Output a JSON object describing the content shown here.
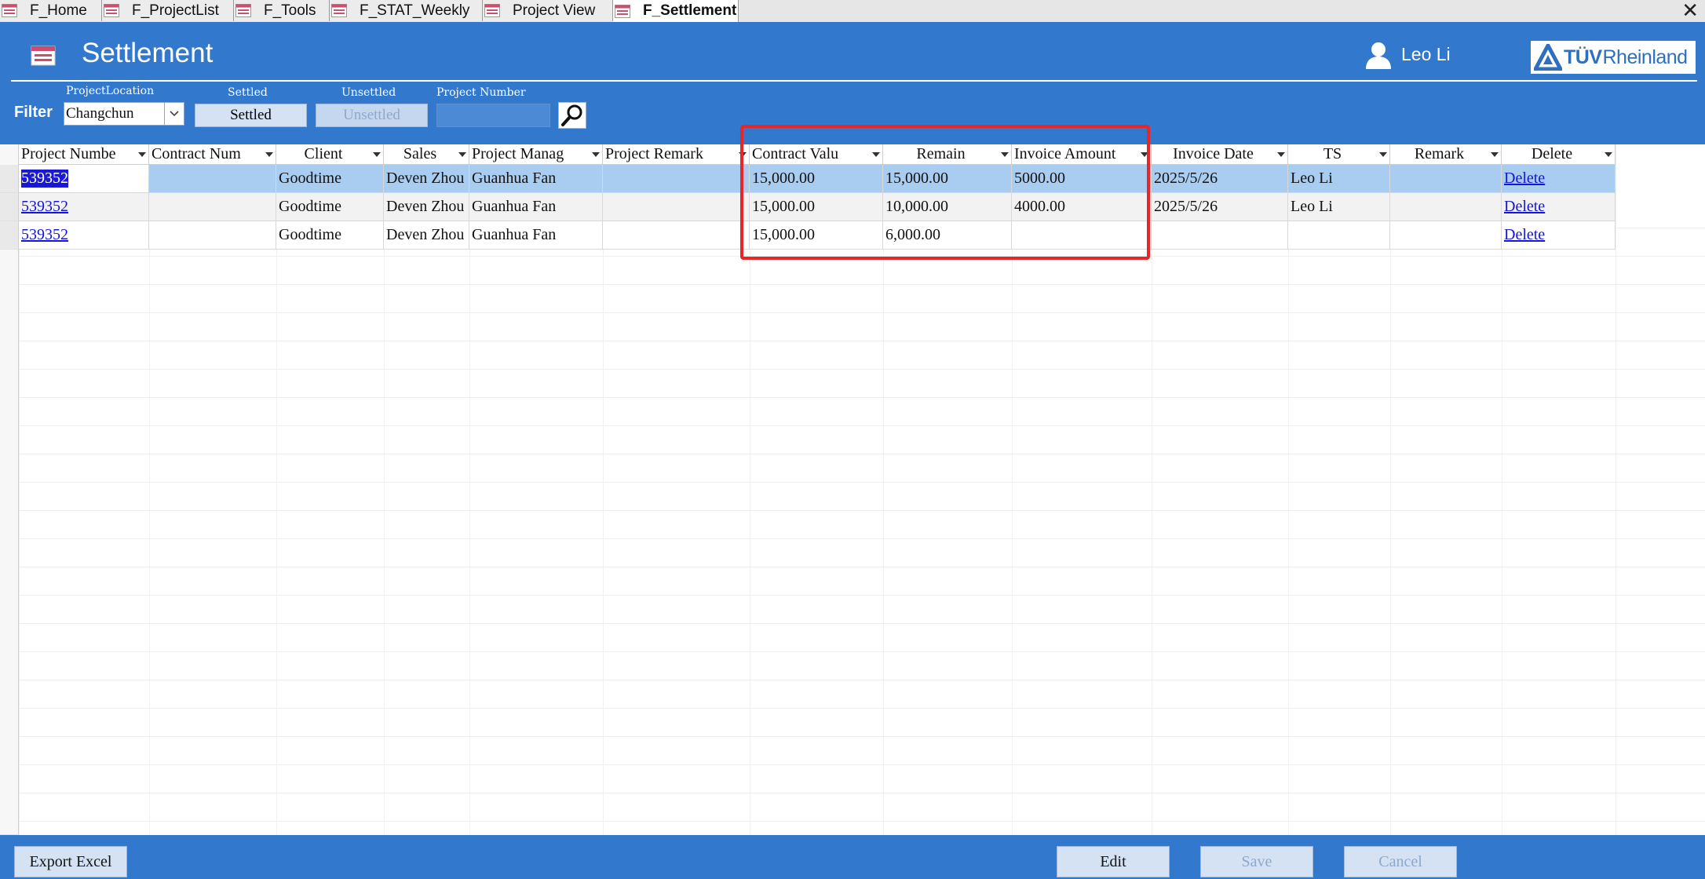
{
  "tabs": [
    {
      "label": "F_Home",
      "active": false
    },
    {
      "label": "F_ProjectList",
      "active": false
    },
    {
      "label": "F_Tools",
      "active": false
    },
    {
      "label": "F_STAT_Weekly",
      "active": false
    },
    {
      "label": "Project View",
      "active": false
    },
    {
      "label": "F_Settlement",
      "active": true
    }
  ],
  "close_glyph": "✕",
  "header": {
    "title": "Settlement",
    "user_name": "Leo Li",
    "logo_text_bold": "TÜV",
    "logo_text": "Rheinland"
  },
  "filter": {
    "label": "Filter",
    "location_label": "ProjectLocation",
    "location_value": "Changchun",
    "settled_caption": "Settled",
    "settled_button": "Settled",
    "unsettled_caption": "Unsettled",
    "unsettled_button": "Unsettled",
    "project_number_caption": "Project Number",
    "project_number_value": ""
  },
  "columns": [
    {
      "label": "Project Numbe",
      "filter": true
    },
    {
      "label": "Contract Num",
      "filter": true
    },
    {
      "label": "Client",
      "filter": true
    },
    {
      "label": "Sales",
      "filter": true
    },
    {
      "label": "Project Manag",
      "filter": true
    },
    {
      "label": "Project Remark",
      "filter": true
    },
    {
      "label": "Contract Valu",
      "filter": true
    },
    {
      "label": "Remain",
      "filter": true
    },
    {
      "label": "Invoice Amount",
      "filter": true
    },
    {
      "label": "Invoice Date",
      "filter": true
    },
    {
      "label": "TS",
      "filter": true
    },
    {
      "label": "Remark",
      "filter": true
    },
    {
      "label": "Delete",
      "filter": true
    }
  ],
  "rows": [
    {
      "selected": true,
      "cells": [
        "539352",
        "",
        "Goodtime",
        "Deven Zhou",
        "Guanhua Fan",
        "",
        "15,000.00",
        "15,000.00",
        "5000.00",
        "2025/5/26",
        "Leo Li",
        "",
        "Delete"
      ]
    },
    {
      "selected": false,
      "cells": [
        "539352",
        "",
        "Goodtime",
        "Deven Zhou",
        "Guanhua Fan",
        "",
        "15,000.00",
        "10,000.00",
        "4000.00",
        "2025/5/26",
        "Leo Li",
        "",
        "Delete"
      ]
    },
    {
      "selected": false,
      "cells": [
        "539352",
        "",
        "Goodtime",
        "Deven Zhou",
        "Guanhua Fan",
        "",
        "15,000.00",
        "6,000.00",
        "",
        "",
        "",
        "",
        "Delete"
      ]
    }
  ],
  "footer": {
    "export_label": "Export Excel",
    "edit_label": "Edit",
    "save_label": "Save",
    "cancel_label": "Cancel"
  },
  "colors": {
    "header_blue": "#3279ce",
    "selected_row": "#a9cdf0",
    "alt_row": "#f2f2f2",
    "highlight_box": "#e8262a",
    "link": "#1515d6"
  }
}
